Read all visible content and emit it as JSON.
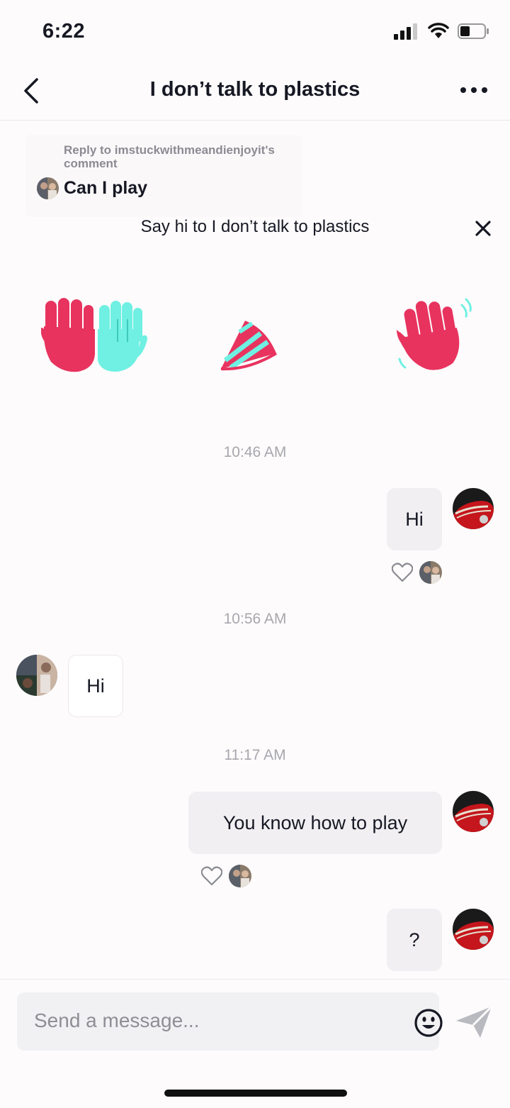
{
  "status_bar": {
    "time": "6:22"
  },
  "header": {
    "title": "I don’t talk to plastics"
  },
  "reply": {
    "label": "Reply to imstuckwithmeandienjoyit's comment",
    "text": "Can I play"
  },
  "say_hi": {
    "text": "Say hi to I don’t talk to plastics"
  },
  "stickers": [
    "high-five-icon",
    "party-hat-icon",
    "waving-hand-icon"
  ],
  "messages": [
    {
      "type": "timestamp",
      "text": "10:46 AM"
    },
    {
      "type": "sent",
      "text": "Hi",
      "liked": true
    },
    {
      "type": "timestamp",
      "text": "10:56 AM"
    },
    {
      "type": "received",
      "text": "Hi"
    },
    {
      "type": "timestamp",
      "text": "11:17 AM"
    },
    {
      "type": "sent",
      "text": "You know how to play",
      "liked": true
    },
    {
      "type": "sent",
      "text": "?"
    }
  ],
  "input": {
    "placeholder": "Send a message..."
  },
  "colors": {
    "accent_pink": "#e8335f",
    "accent_teal": "#6ff0e2",
    "bubble_sent": "#f1eff2"
  }
}
